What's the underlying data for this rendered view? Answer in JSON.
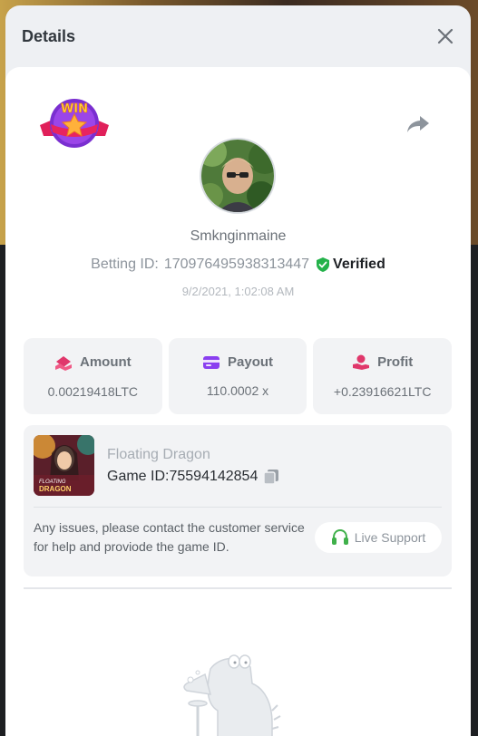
{
  "modal": {
    "title": "Details"
  },
  "badge": {
    "text": "WIN"
  },
  "player": {
    "username": "Smknginmaine",
    "betting_id_label": "Betting ID:",
    "betting_id": "170976495938313447",
    "verified_label": "Verified",
    "timestamp": "9/2/2021, 1:02:08 AM"
  },
  "stats": [
    {
      "label": "Amount",
      "value": "0.00219418LTC",
      "icon": "amount-icon",
      "color": "#e0376b"
    },
    {
      "label": "Payout",
      "value": "110.0002 x",
      "icon": "card-icon",
      "color": "#8a3ff0"
    },
    {
      "label": "Profit",
      "value": "+0.23916621LTC",
      "icon": "profit-hand-icon",
      "color": "#e0376b"
    }
  ],
  "game": {
    "thumb_line1": "FLOATING",
    "thumb_line2": "DRAGON",
    "name": "Floating Dragon",
    "id_label": "Game ID:",
    "id": "75594142854"
  },
  "support": {
    "text": "Any issues, please contact the customer service for help and proviode the game ID.",
    "button_label": "Live Support"
  },
  "colors": {
    "verified_green": "#24b24a",
    "support_green": "#3fb04a",
    "panel_bg": "#f2f3f5"
  }
}
